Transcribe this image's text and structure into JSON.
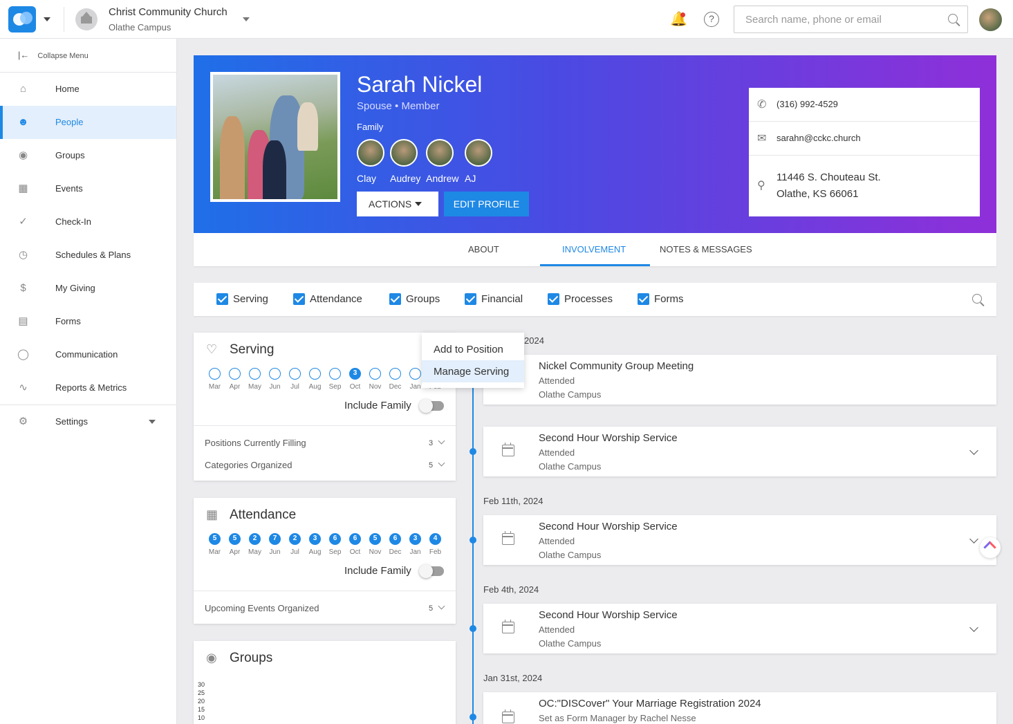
{
  "header": {
    "church_name": "Christ Community Church",
    "campus": "Olathe Campus",
    "search_placeholder": "Search name, phone or email",
    "help_label": "?"
  },
  "sidebar": {
    "collapse_label": "Collapse Menu",
    "items": [
      {
        "label": "Home",
        "icon": "home-icon"
      },
      {
        "label": "People",
        "icon": "people-icon",
        "active": true
      },
      {
        "label": "Groups",
        "icon": "groups-icon"
      },
      {
        "label": "Events",
        "icon": "calendar-icon"
      },
      {
        "label": "Check-In",
        "icon": "check-circle-icon"
      },
      {
        "label": "Schedules & Plans",
        "icon": "clock-icon"
      },
      {
        "label": "My Giving",
        "icon": "dollar-icon"
      },
      {
        "label": "Forms",
        "icon": "clipboard-icon"
      },
      {
        "label": "Communication",
        "icon": "chat-icon"
      },
      {
        "label": "Reports & Metrics",
        "icon": "pulse-icon"
      }
    ],
    "settings_label": "Settings"
  },
  "profile": {
    "name": "Sarah Nickel",
    "role": "Spouse • Member",
    "family_label": "Family",
    "family": [
      "Clay",
      "Audrey",
      "Andrew",
      "AJ"
    ],
    "actions_label": "ACTIONS",
    "edit_label": "EDIT PROFILE",
    "phone": "(316) 992-4529",
    "email": "sarahn@cckc.church",
    "address_line1": "11446 S. Chouteau St.",
    "address_line2": "Olathe, KS 66061"
  },
  "tabs": [
    {
      "label": "ABOUT"
    },
    {
      "label": "INVOLVEMENT",
      "active": true
    },
    {
      "label": "NOTES & MESSAGES"
    }
  ],
  "filters": [
    "Serving",
    "Attendance",
    "Groups",
    "Financial",
    "Processes",
    "Forms"
  ],
  "months": [
    "Mar",
    "Apr",
    "May",
    "Jun",
    "Jul",
    "Aug",
    "Sep",
    "Oct",
    "Nov",
    "Dec",
    "Jan",
    "Feb"
  ],
  "serving": {
    "title": "Serving",
    "counts": [
      "",
      "",
      "",
      "",
      "",
      "",
      "",
      "3",
      "",
      "",
      "",
      ""
    ],
    "include_family": "Include Family",
    "stats": [
      {
        "label": "Positions Currently Filling",
        "value": "3"
      },
      {
        "label": "Categories Organized",
        "value": "5"
      }
    ]
  },
  "attendance": {
    "title": "Attendance",
    "counts": [
      "5",
      "5",
      "2",
      "7",
      "2",
      "3",
      "6",
      "6",
      "5",
      "6",
      "3",
      "4"
    ],
    "include_family": "Include Family",
    "stats": [
      {
        "label": "Upcoming Events Organized",
        "value": "5"
      }
    ]
  },
  "groups": {
    "title": "Groups",
    "axis": [
      "30",
      "25",
      "20",
      "15",
      "10"
    ]
  },
  "menu": {
    "items": [
      "Add to Position",
      "Manage Serving"
    ]
  },
  "timeline": {
    "first_date_fragment": "2024",
    "events": [
      {
        "title": "Nickel Community Group Meeting",
        "status": "Attended",
        "campus": "Olathe Campus"
      },
      {
        "title": "Second Hour Worship Service",
        "status": "Attended",
        "campus": "Olathe Campus"
      },
      {
        "date": "Feb 11th, 2024",
        "title": "Second Hour Worship Service",
        "status": "Attended",
        "campus": "Olathe Campus"
      },
      {
        "date": "Feb 4th, 2024",
        "title": "Second Hour Worship Service",
        "status": "Attended",
        "campus": "Olathe Campus"
      },
      {
        "date": "Jan 31st, 2024",
        "title": "OC:\"DISCover\" Your Marriage Registration 2024",
        "status": "Set as Form Manager by Rachel Nesse"
      }
    ]
  }
}
